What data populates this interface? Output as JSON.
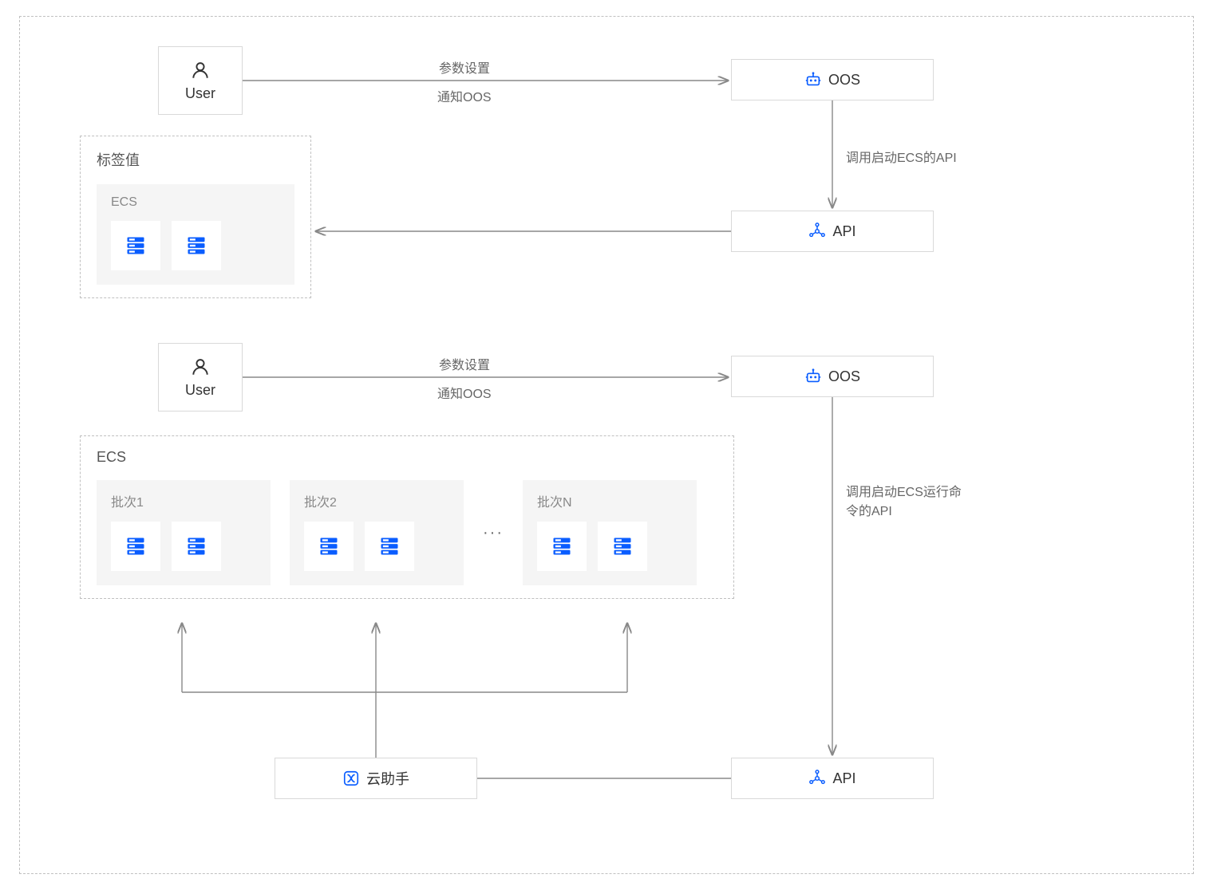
{
  "colors": {
    "accent": "#0a5dff",
    "line": "#888888",
    "border": "#d9d9d9",
    "dash": "#c0c0c0",
    "text": "#333333",
    "muted": "#888888"
  },
  "nodes": {
    "user1": "User",
    "user2": "User",
    "oos1": "OOS",
    "oos2": "OOS",
    "api1": "API",
    "api2": "API",
    "assistant": "云助手"
  },
  "boxes": {
    "tag_values_title": "标签值",
    "tag_values_sub": "ECS",
    "ecs_title": "ECS",
    "batch1": "批次1",
    "batch2": "批次2",
    "batchN": "批次N",
    "ellipsis": "···"
  },
  "arrows": {
    "user_to_oos_top_a": "参数设置",
    "user_to_oos_top_b": "通知OOS",
    "oos_to_api_top": "调用启动ECS的API",
    "user_to_oos_bot_a": "参数设置",
    "user_to_oos_bot_b": "通知OOS",
    "oos_to_api_bot": "调用启动ECS运行命令的API"
  },
  "icons": {
    "user": "user-icon",
    "oos": "robot-icon",
    "api": "api-icon",
    "server": "server-icon",
    "assistant": "assistant-icon"
  }
}
